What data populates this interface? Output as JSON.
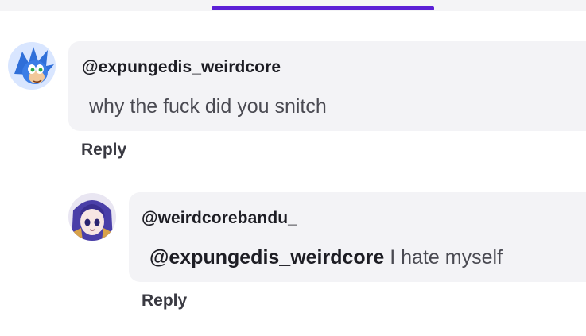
{
  "comments": [
    {
      "username": "@expungedis_weirdcore",
      "text": "why the fuck did you snitch",
      "reply_label": "Reply"
    },
    {
      "username": "@weirdcorebandu_",
      "mention": "@expungedis_weirdcore",
      "text": " I hate myself",
      "reply_label": "Reply"
    }
  ],
  "colors": {
    "accent": "#5b1fd6",
    "bubble": "#f3f3f6"
  }
}
